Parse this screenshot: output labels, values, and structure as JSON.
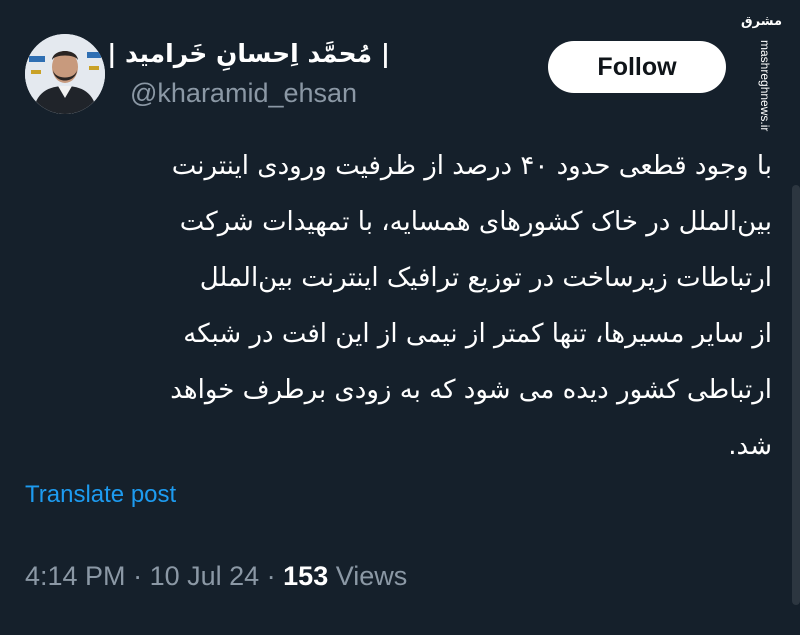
{
  "author": {
    "display_name": "| مُحمَّد اِحسانِ خَرامید |",
    "handle": "@kharamid_ehsan"
  },
  "follow_button": {
    "label": "Follow"
  },
  "watermark": {
    "logo_text": "مشرق",
    "site": "mashreghnews.ir"
  },
  "tweet": {
    "lines": [
      "با وجود قطعی حدود ۴۰ درصد از ظرفیت ورودی اینترنت",
      "بین‌الملل در خاک کشورهای همسایه، با تمهیدات شرکت",
      "ارتباطات زیرساخت در توزیع ترافیک اینترنت بین‌الملل",
      "از سایر مسیرها، تنها کمتر از نیمی از این افت در شبکه",
      "ارتباطی کشور دیده می شود که به زودی برطرف خواهد",
      "شد."
    ]
  },
  "translate_link": "Translate post",
  "meta": {
    "time": "4:14 PM",
    "separator": " · ",
    "date": "10 Jul 24",
    "views_count": "153",
    "views_label": " Views"
  },
  "colors": {
    "background": "#15202b",
    "text_primary": "#ffffff",
    "text_secondary": "#8b98a5",
    "link": "#1d9bf0"
  }
}
